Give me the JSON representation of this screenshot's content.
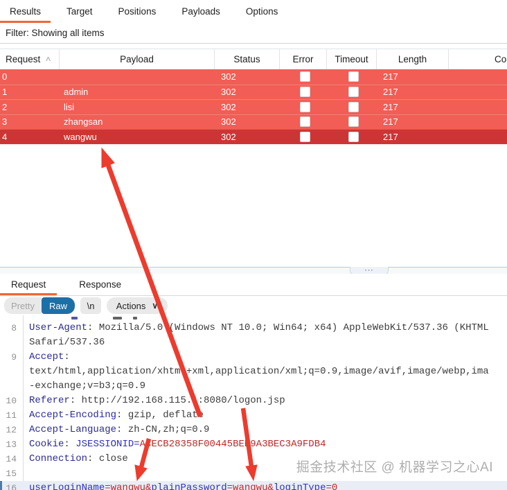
{
  "accent_colors": {
    "tab_underline_orange": "#ee6832",
    "row_highlight_red": "#f25d55",
    "row_selected_red": "#cd3535",
    "raw_button_blue": "#1d6fa8",
    "arrow_red": "#ed3b2d"
  },
  "top_tabs": {
    "active_index": 0,
    "items": [
      {
        "label": "Results"
      },
      {
        "label": "Target"
      },
      {
        "label": "Positions"
      },
      {
        "label": "Payloads"
      },
      {
        "label": "Options"
      }
    ]
  },
  "filter_bar": {
    "label": "Filter: Showing all items"
  },
  "results_table": {
    "columns": [
      "Request",
      "Payload",
      "Status",
      "Error",
      "Timeout",
      "Length",
      "Co"
    ],
    "sort_column": "Request",
    "rows": [
      {
        "request": "0",
        "payload": "",
        "status": "302",
        "error_checked": false,
        "timeout_checked": false,
        "length": "217",
        "selected": false
      },
      {
        "request": "1",
        "payload": "admin",
        "status": "302",
        "error_checked": false,
        "timeout_checked": false,
        "length": "217",
        "selected": false
      },
      {
        "request": "2",
        "payload": "lisi",
        "status": "302",
        "error_checked": false,
        "timeout_checked": false,
        "length": "217",
        "selected": false
      },
      {
        "request": "3",
        "payload": "zhangsan",
        "status": "302",
        "error_checked": false,
        "timeout_checked": false,
        "length": "217",
        "selected": false
      },
      {
        "request": "4",
        "payload": "wangwu",
        "status": "302",
        "error_checked": false,
        "timeout_checked": false,
        "length": "217",
        "selected": true
      }
    ]
  },
  "message_panel": {
    "tabs": {
      "active_index": 0,
      "items": [
        {
          "label": "Request"
        },
        {
          "label": "Response"
        }
      ]
    },
    "toolbar": {
      "pretty_label": "Pretty",
      "raw_label": "Raw",
      "newline_label": "\\n",
      "actions_label": "Actions"
    },
    "editor_lines": [
      {
        "num": "8",
        "hl": false,
        "segments": [
          {
            "t": "User-Agent",
            "c": "name"
          },
          {
            "t": ": ",
            "c": "plain"
          },
          {
            "t": "Mozilla/5.0 (Windows NT 10.0; Win64; x64) AppleWebKit/537.36 (KHTML",
            "c": "plain"
          }
        ]
      },
      {
        "num": "",
        "hl": false,
        "segments": [
          {
            "t": "Safari/537.36",
            "c": "plain"
          }
        ]
      },
      {
        "num": "9",
        "hl": false,
        "segments": [
          {
            "t": "Accept",
            "c": "name"
          },
          {
            "t": ":",
            "c": "plain"
          }
        ]
      },
      {
        "num": "",
        "hl": false,
        "segments": [
          {
            "t": "text/html,application/xhtml+xml,application/xml;q=0.9,image/avif,image/webp,ima",
            "c": "plain"
          }
        ]
      },
      {
        "num": "",
        "hl": false,
        "segments": [
          {
            "t": "-exchange;v=b3;q=0.9",
            "c": "plain"
          }
        ]
      },
      {
        "num": "10",
        "hl": false,
        "segments": [
          {
            "t": "Referer",
            "c": "name"
          },
          {
            "t": ": ",
            "c": "plain"
          },
          {
            "t": "http://192.168.115.1:8080/logon.jsp",
            "c": "plain"
          }
        ]
      },
      {
        "num": "11",
        "hl": false,
        "segments": [
          {
            "t": "Accept-Encoding",
            "c": "name"
          },
          {
            "t": ": ",
            "c": "plain"
          },
          {
            "t": "gzip, deflate",
            "c": "plain"
          }
        ]
      },
      {
        "num": "12",
        "hl": false,
        "segments": [
          {
            "t": "Accept-Language",
            "c": "name"
          },
          {
            "t": ": ",
            "c": "plain"
          },
          {
            "t": "zh-CN,zh;q=0.9",
            "c": "plain"
          }
        ]
      },
      {
        "num": "13",
        "hl": false,
        "segments": [
          {
            "t": "Cookie",
            "c": "name"
          },
          {
            "t": ": ",
            "c": "plain"
          },
          {
            "t": "JSESSIONID=",
            "c": "param"
          },
          {
            "t": "ACECB28358F00445BEB9A3BEC3A9FDB4",
            "c": "val"
          }
        ]
      },
      {
        "num": "14",
        "hl": false,
        "segments": [
          {
            "t": "Connection",
            "c": "name"
          },
          {
            "t": ": ",
            "c": "plain"
          },
          {
            "t": "close",
            "c": "plain"
          }
        ]
      },
      {
        "num": "15",
        "hl": false,
        "segments": []
      },
      {
        "num": "16",
        "hl": true,
        "segments": [
          {
            "t": "userLoginName",
            "c": "param"
          },
          {
            "t": "=wangwu&",
            "c": "val"
          },
          {
            "t": "plainPassword",
            "c": "param"
          },
          {
            "t": "=wangwu&",
            "c": "val"
          },
          {
            "t": "loginType",
            "c": "param"
          },
          {
            "t": "=0",
            "c": "val"
          }
        ]
      }
    ]
  },
  "icons": {
    "sort_ascending": "∧",
    "chevron_down": "∨",
    "splitter_grip": "⋯"
  },
  "watermark": {
    "text": "掘金技术社区 @ 机器学习之心AI"
  }
}
